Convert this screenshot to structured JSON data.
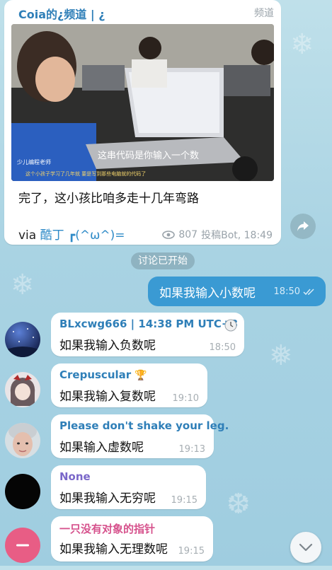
{
  "channel_post": {
    "title": "Coia的¿频道 | ¿",
    "tag": "频道",
    "video": {
      "watermark": "少儿编程老师",
      "subtitle": "这串代码是你输入一个数",
      "overlay_text": "这个小孩子学习了几年就  要是写到那些电脑就的代码了"
    },
    "caption": "完了，这小孩比咱多走十几年弯路",
    "via_prefix": "via ",
    "author": "酷丁 ┏(^ω^)=",
    "views": "807",
    "signature": "投稿Bot, 18:49"
  },
  "service_message": "讨论已开始",
  "outgoing": {
    "text": "如果我输入小数呢",
    "time": "18:50"
  },
  "messages": [
    {
      "sender": "BLxcwg666 | 14:38 PM UTC+8",
      "sender_color": "#2f7fb8",
      "text": "如果我输入负数呢",
      "time": "18:50",
      "avatar": "night-sky"
    },
    {
      "sender": "Crepuscular",
      "sender_color": "#2f7fb8",
      "text": "如果我输入复数呢",
      "time": "19:10",
      "avatar": "anime-girl"
    },
    {
      "sender": "Please don't shake your leg.",
      "sender_color": "#2f7fb8",
      "text": "如果输入虚数呢",
      "time": "19:13",
      "avatar": "person"
    },
    {
      "sender": "None",
      "sender_color": "#7a67c9",
      "text": "如果我输入无穷呢",
      "time": "19:15",
      "avatar": "black"
    },
    {
      "sender": "一只没有对象的指针",
      "sender_color": "#d6518c",
      "text": "如果我输入无理数呢",
      "time": "19:15",
      "avatar": "pink-minus"
    }
  ],
  "colors": {
    "accent": "#3a9ad3",
    "link": "#2f8bc8",
    "avatar_pink": "#e85d85"
  }
}
